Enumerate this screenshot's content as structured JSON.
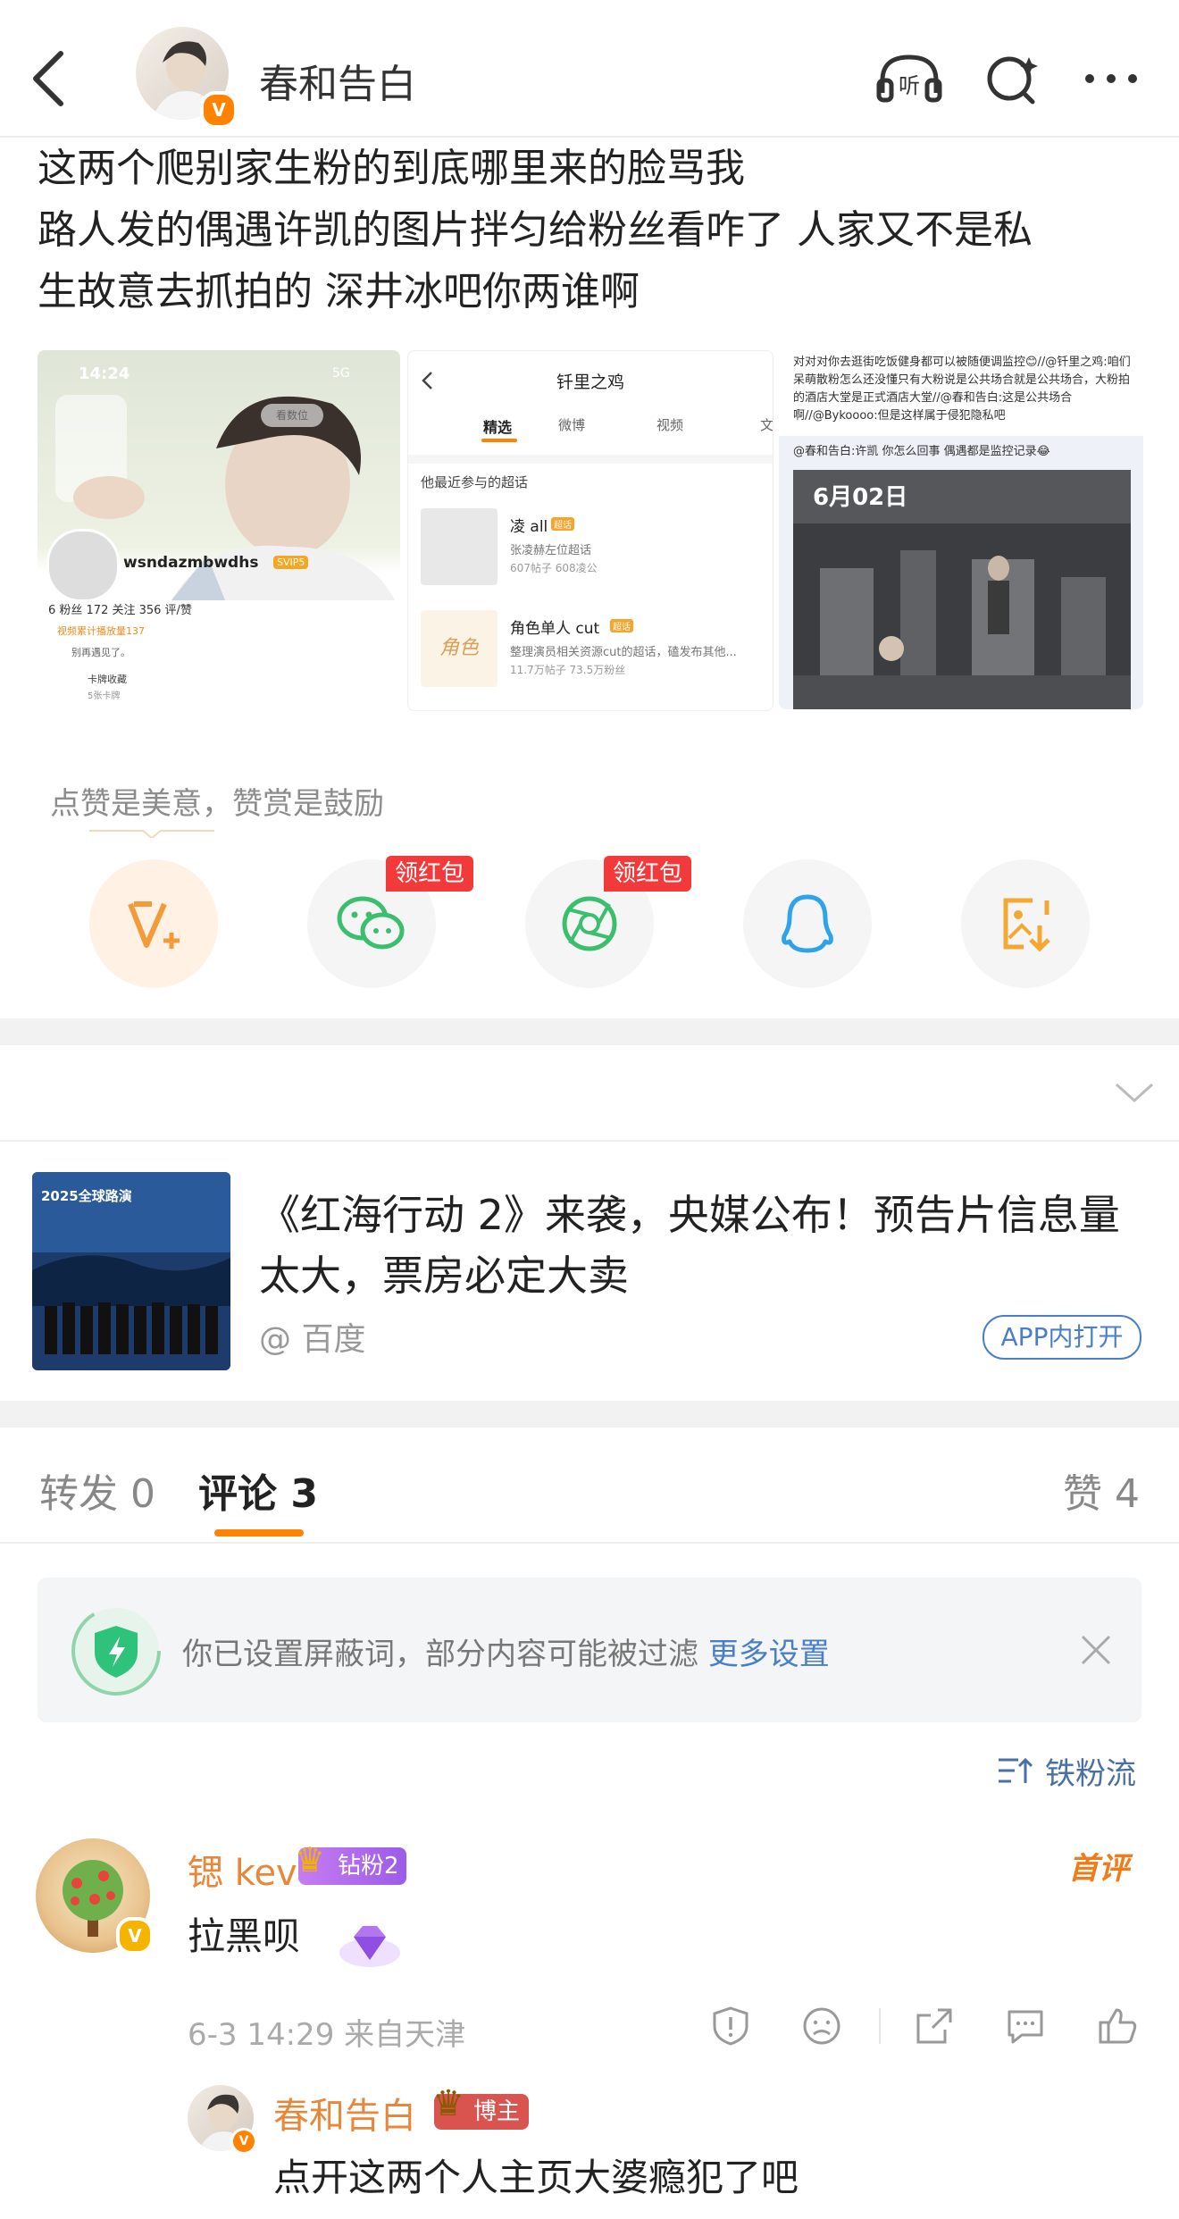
{
  "header": {
    "author_name": "春和告白",
    "verified_mark": "V",
    "listen_label": "听"
  },
  "post": {
    "lines": [
      "这两个爬别家生粉的到底哪里来的脸骂我",
      "路人发的偶遇许凯的图片拌匀给粉丝看咋了 人家又不是私",
      "生故意去抓拍的 深井冰吧你两谁啊"
    ]
  },
  "images": {
    "img1": {
      "time": "14:24",
      "signal": "5G",
      "follow_btn": "看数位",
      "username": "wsndazmbwdhs",
      "vip": "SVIP5",
      "stats": "6 粉丝   172 关注   356 评/赞",
      "line1": "视频累计播放量137",
      "line2": "别再遇见了。",
      "line3": "卡牌收藏",
      "line4": "5张卡牌"
    },
    "img2": {
      "title": "钎里之鸡",
      "tab_featured": "精选",
      "tab_weibo": "微博",
      "tab_video": "视频",
      "tab_more": "文",
      "section": "他最近参与的超话",
      "item1_name": "凌 all",
      "item1_tag": "超话",
      "item1_desc": "张凌赫左位超话",
      "item1_stats": "607帖子 608凌公",
      "item2_name": "角色单人 cut",
      "item2_tag": "超话",
      "item2_desc": "整理演员相关资源cut的超话，磕发布其他...",
      "item2_stats": "11.7万帖子 73.5万粉丝"
    },
    "img3": {
      "text1": "对对对你去逛街吃饭健身都可以被随便调监控😊//@钎里之鸡:咱们呆萌散粉怎么还没懂只有大粉说是公共场合就是公共场合，大粉拍的酒店大堂是正式酒店大堂//@春和告白:这是公共场合啊//@Bykoooo:但是这样属于侵犯隐私吧",
      "text2": "@春和告白:许凯 你怎么回事 偶遇都是监控记录😂",
      "video_date": "6月02日"
    }
  },
  "reward": {
    "caption": "点赞是美意，赞赏是鼓励",
    "hongbao1": "领红包",
    "hongbao2": "领红包"
  },
  "ad": {
    "thumb_text": "2025全球路演",
    "title": "《红海行动 2》来袭，央媒公布！预告片信息量太大，票房必定大卖",
    "source": "@ 百度",
    "open_btn": "APP内打开"
  },
  "tabs": {
    "repost": "转发 0",
    "comment": "评论 3",
    "like": "赞 4"
  },
  "notice": {
    "text": "你已设置屏蔽词，部分内容可能被过滤",
    "link": "更多设置"
  },
  "sort": {
    "label": "铁粉流"
  },
  "comment": {
    "user": "锶 kev",
    "fan_badge": "钻粉2",
    "first_tag": "首评",
    "text": "拉黑呗",
    "meta": "6-3 14:29  来自天津",
    "reply": {
      "user": "春和告白",
      "badge": "博主",
      "text": "点开这两个人主页大婆瘾犯了吧"
    }
  },
  "colors": {
    "accent": "#ff8200",
    "link": "#4a7fc8",
    "hongbao": "#f33a3a",
    "username": "#e8873a"
  }
}
